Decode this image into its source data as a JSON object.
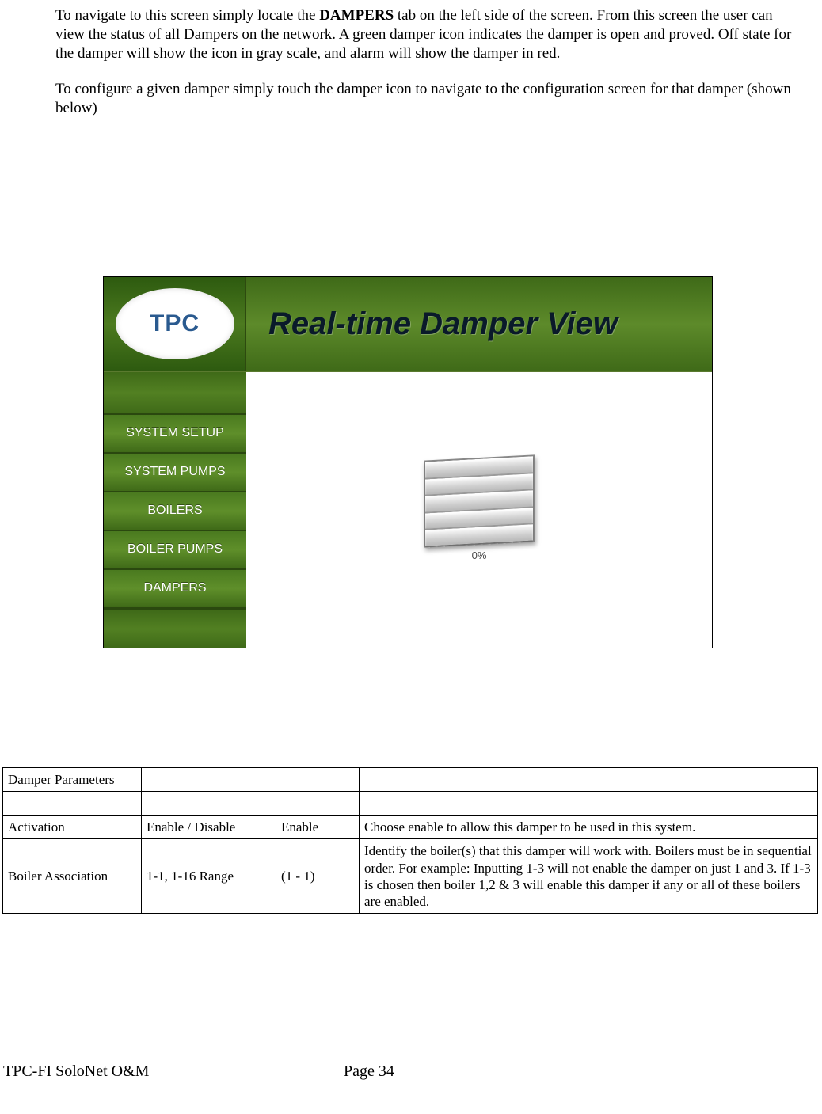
{
  "para1_pre": "To navigate to this screen simply locate the ",
  "para1_bold": "DAMPERS",
  "para1_post": " tab on the left side of the screen.  From this screen the user can view the status of all Dampers on the network.  A green damper icon indicates the damper is open and proved.  Off state for the damper will show the icon in gray scale, and alarm will show the damper in red.",
  "para2": "To configure a given damper simply touch the damper icon to navigate to the configuration screen for that damper (shown below)",
  "screenshot": {
    "logo": "TPC",
    "title": "Real-time Damper View",
    "tabs": [
      "SYSTEM SETUP",
      "SYSTEM PUMPS",
      "BOILERS",
      "BOILER PUMPS",
      "DAMPERS"
    ],
    "damper_pct": "0%"
  },
  "table": {
    "header": "Damper Parameters",
    "rows": [
      {
        "name": "Activation",
        "range": "Enable / Disable",
        "default": "Enable",
        "desc": "Choose enable to allow this damper to be used in this system."
      },
      {
        "name": "Boiler Association",
        "range": "1-1, 1-16 Range",
        "default": "(1 - 1)",
        "desc": "Identify the boiler(s) that this damper will work with.  Boilers must be in sequential order.  For example: Inputting 1-3 will not enable the damper on just 1 and 3.  If 1-3 is chosen then boiler 1,2 & 3 will enable this damper if any or all of these boilers are enabled."
      }
    ]
  },
  "footer": {
    "doc": "TPC-FI SoloNet O&M",
    "page": "Page 34"
  }
}
